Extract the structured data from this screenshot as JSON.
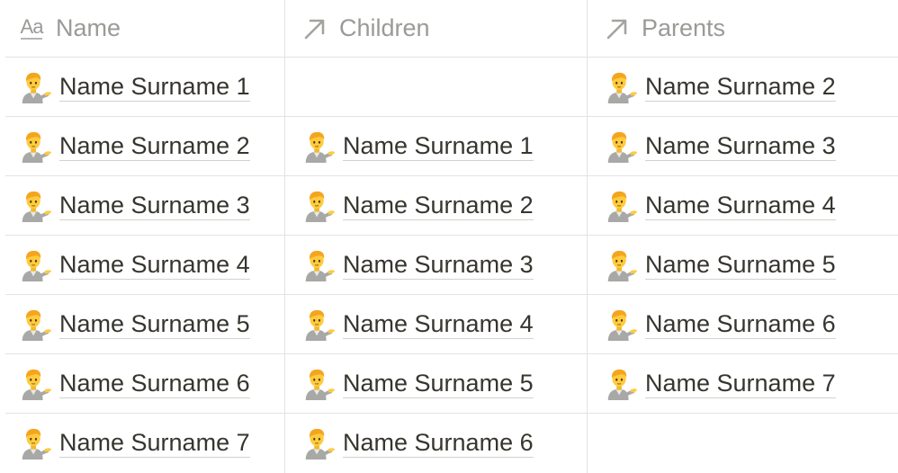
{
  "columns": {
    "name": "Name",
    "children": "Children",
    "parents": "Parents"
  },
  "icons": {
    "title_property": "text-aa-icon",
    "relation_property": "arrow-up-right-icon",
    "person": "person-tipping-hand-emoji"
  },
  "colors": {
    "text": "#37352f",
    "muted": "#9a9a97",
    "border": "#e3e3e1"
  },
  "rows": [
    {
      "name": "Name Surname 1",
      "children": "",
      "parents": "Name Surname 2"
    },
    {
      "name": "Name Surname 2",
      "children": "Name Surname 1",
      "parents": "Name Surname 3"
    },
    {
      "name": "Name Surname 3",
      "children": "Name Surname 2",
      "parents": "Name Surname 4"
    },
    {
      "name": "Name Surname 4",
      "children": "Name Surname 3",
      "parents": "Name Surname 5"
    },
    {
      "name": "Name Surname 5",
      "children": "Name Surname 4",
      "parents": "Name Surname 6"
    },
    {
      "name": "Name Surname 6",
      "children": "Name Surname 5",
      "parents": "Name Surname 7"
    },
    {
      "name": "Name Surname 7",
      "children": "Name Surname 6",
      "parents": ""
    }
  ]
}
